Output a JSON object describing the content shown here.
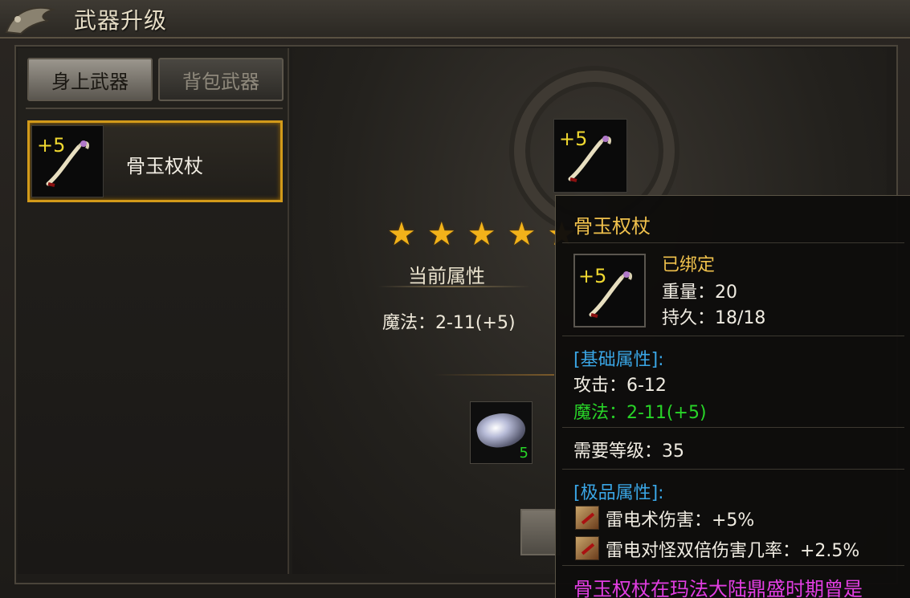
{
  "window": {
    "title": "武器升级"
  },
  "tabs": [
    {
      "label": "身上武器",
      "active": true
    },
    {
      "label": "背包武器",
      "active": false
    }
  ],
  "weapon_list": [
    {
      "level": "+5",
      "name": "骨玉权杖",
      "icon": "bone-jade-staff-icon"
    }
  ],
  "upgrade": {
    "slot_level": "+5",
    "stars": 5,
    "current_attr_heading": "当前属性",
    "current_magic": "魔法：2-11(+5)",
    "material": {
      "icon": "gem-ore-icon",
      "count": "5"
    }
  },
  "tooltip": {
    "name": "骨玉权杖",
    "level": "+5",
    "bound": "已绑定",
    "weight": "重量：20",
    "durability": "持久：18/18",
    "base_heading": "[基础属性]:",
    "attack": "攻击：6-12",
    "magic": "魔法：2-11(+5)",
    "req_level": "需要等级：35",
    "premium_heading": "[极品属性]:",
    "premium": [
      {
        "icon": "lightning-skill-icon",
        "text": "雷电术伤害：+5%"
      },
      {
        "icon": "lightning-skill-icon",
        "text": "雷电对怪双倍伤害几率：+2.5%"
      }
    ],
    "description": "骨玉权杖在玛法大陆鼎盛时期曾是"
  },
  "colors": {
    "gold": "#f0c14c",
    "plus_yellow": "#f0d830",
    "green": "#28d428",
    "blue": "#3aa6e6",
    "magenta": "#e23ee2",
    "selection_border": "#d29a1a"
  }
}
